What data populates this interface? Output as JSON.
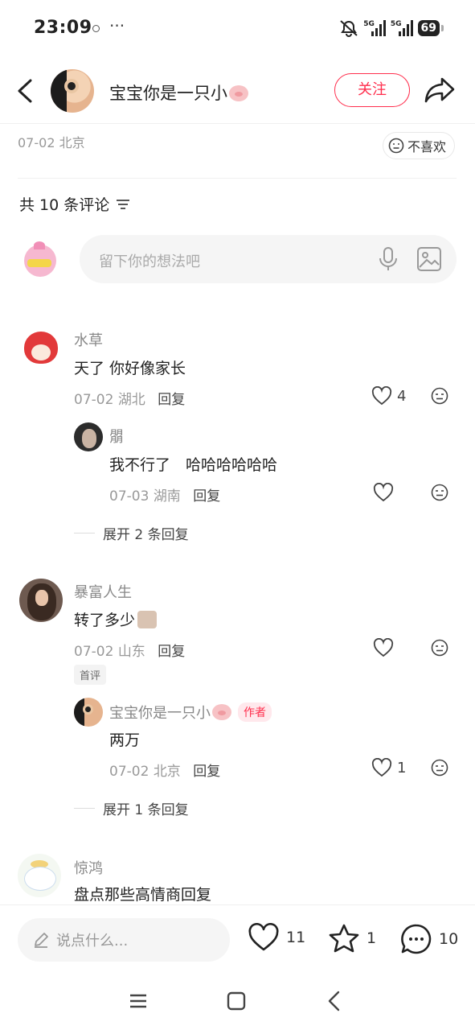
{
  "status_bar": {
    "time": "23:09",
    "more": "···",
    "net1": "5G",
    "net2": "5G",
    "battery": "69"
  },
  "header": {
    "author_name": "宝宝你是一只小",
    "follow_label": "关注"
  },
  "post": {
    "meta": "07-02 北京",
    "dislike_label": "不喜欢"
  },
  "comments_header": {
    "count_label": "共 10 条评论"
  },
  "comment_input": {
    "placeholder": "留下你的想法吧"
  },
  "comments": [
    {
      "name": "水草",
      "text": "天了 你好像家长",
      "date": "07-02",
      "location": "湖北",
      "reply_label": "回复",
      "likes": "4",
      "replies": [
        {
          "name": "朤",
          "text": "我不行了　哈哈哈哈哈哈",
          "date": "07-03",
          "location": "湖南",
          "reply_label": "回复"
        }
      ],
      "expand_label": "展开 2 条回复"
    },
    {
      "name": "暴富人生",
      "text": "转了多少",
      "date": "07-02",
      "location": "山东",
      "reply_label": "回复",
      "badge": "首评",
      "replies": [
        {
          "name": "宝宝你是一只小",
          "author_badge": "作者",
          "text": "两万",
          "date": "07-02",
          "location": "北京",
          "reply_label": "回复",
          "likes": "1"
        }
      ],
      "expand_label": "展开 1 条回复"
    },
    {
      "name": "惊鸿",
      "text": "盘点那些高情商回复"
    }
  ],
  "bottom_bar": {
    "say_placeholder": "说点什么...",
    "likes": "11",
    "stars": "1",
    "comments": "10"
  },
  "colors": {
    "accent": "#ff2e4d",
    "text_primary": "#222222",
    "text_secondary": "#999999"
  }
}
